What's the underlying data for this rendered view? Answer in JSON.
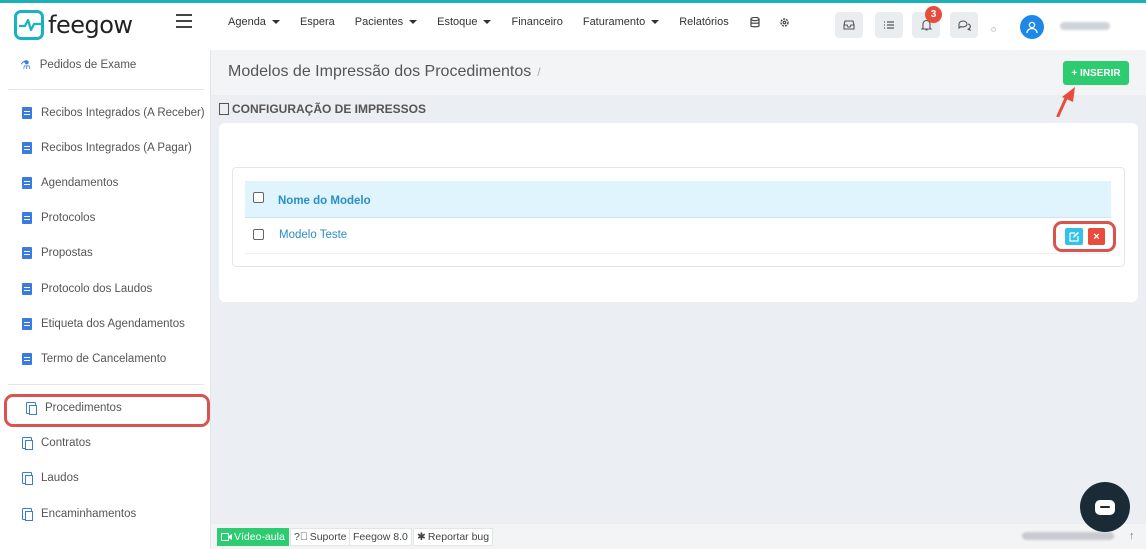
{
  "brand": {
    "name": "feegow",
    "accent": "#17b3c0"
  },
  "nav": {
    "items": [
      {
        "label": "Agenda",
        "dropdown": true
      },
      {
        "label": "Espera",
        "dropdown": false
      },
      {
        "label": "Pacientes",
        "dropdown": true
      },
      {
        "label": "Estoque",
        "dropdown": true
      },
      {
        "label": "Financeiro",
        "dropdown": false
      },
      {
        "label": "Faturamento",
        "dropdown": true
      },
      {
        "label": "Relatórios",
        "dropdown": false
      }
    ],
    "icons": [
      "database-icon",
      "gear-icon"
    ]
  },
  "toolbar": {
    "notifications_count": "3",
    "icons": [
      "inbox-icon",
      "tasks-icon",
      "bell-icon",
      "chat-icon"
    ]
  },
  "sidebar": {
    "top_item": "Pedidos de Exame",
    "doc_items": [
      "Recibos Integrados (A Receber)",
      "Recibos Integrados (A Pagar)",
      "Agendamentos",
      "Protocolos",
      "Propostas",
      "Protocolo dos Laudos",
      "Etiqueta dos Agendamentos",
      "Termo de Cancelamento"
    ],
    "copy_items": [
      "Procedimentos",
      "Contratos",
      "Laudos",
      "Encaminhamentos"
    ],
    "active": "Procedimentos"
  },
  "page": {
    "title": "Modelos de Impressão dos Procedimentos",
    "breadcrumb_sep": "/",
    "insert_label": "+ INSERIR",
    "section_title": "CONFIGURAÇÃO DE IMPRESSOS"
  },
  "table": {
    "header": "Nome do Modelo",
    "rows": [
      {
        "name": "Modelo Teste"
      }
    ],
    "edit_icon": "edit-icon",
    "delete_icon": "close-icon"
  },
  "footer": {
    "video": "Vídeo-aula",
    "support": "Suporte",
    "version": "Feegow 8.0",
    "bug": "Reportar bug"
  },
  "colors": {
    "success": "#2ecc71",
    "danger": "#e74c3c",
    "info": "#35c2e8",
    "highlight": "#d9534f"
  }
}
